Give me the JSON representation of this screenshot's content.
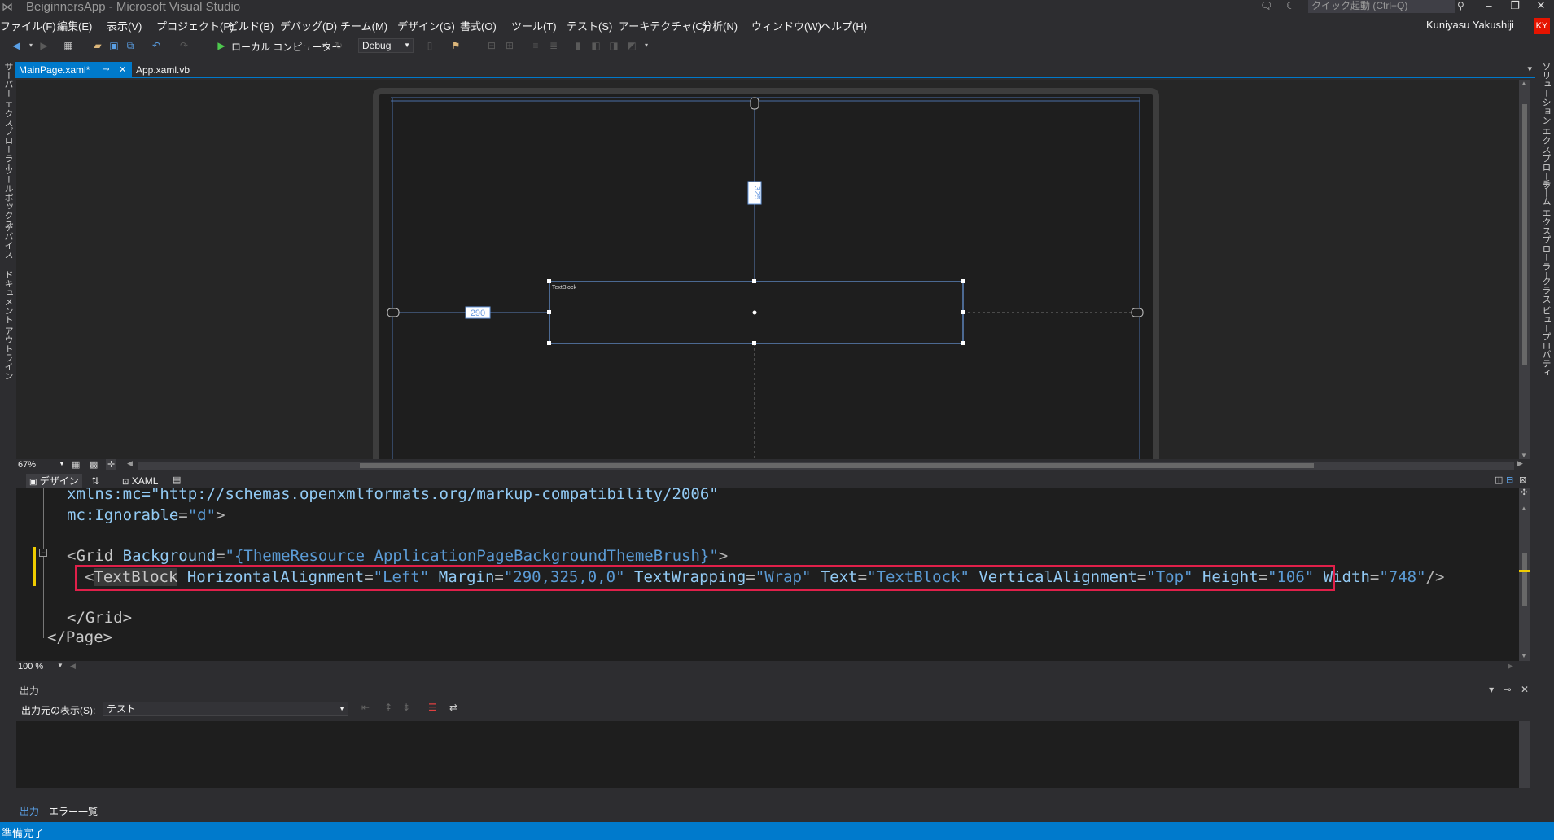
{
  "window": {
    "title": "BeiginnersApp - Microsoft Visual Studio",
    "quick_launch_placeholder": "クイック起動 (Ctrl+Q)",
    "user_name": "Kuniyasu Yakushiji",
    "user_initials": "KY"
  },
  "menu": [
    "ファイル(F)",
    "編集(E)",
    "表示(V)",
    "プロジェクト(P)",
    "ビルド(B)",
    "デバッグ(D)",
    "チーム(M)",
    "デザイン(G)",
    "書式(O)",
    "ツール(T)",
    "テスト(S)",
    "アーキテクチャ(C)",
    "分析(N)",
    "ウィンドウ(W)",
    "ヘルプ(H)"
  ],
  "toolbar": {
    "run_target": "ローカル コンピューター",
    "configuration": "Debug"
  },
  "left_tool_tabs": [
    "サーバー エクスプローラー",
    "ツールボックス",
    "デバイス",
    "ドキュメント アウトライン"
  ],
  "right_tool_tabs": [
    "ソリューション エクスプローラー",
    "チーム エクスプローラー",
    "クラス ビュー",
    "プロパティ"
  ],
  "doc_tabs": [
    {
      "label": "MainPage.xaml*",
      "active": true
    },
    {
      "label": "App.xaml.vb",
      "active": false
    }
  ],
  "designer": {
    "element_label": "TextBlock",
    "margin_top": "325",
    "margin_left": "290",
    "zoom": "67%"
  },
  "split_tabs": {
    "design": "デザイン",
    "swap": "⇅",
    "xaml": "XAML"
  },
  "code": {
    "line1": "xmlns:mc=\"http://schemas.openxmlformats.org/markup-compatibility/2006\"",
    "line2_attr": "mc:Ignorable",
    "line2_val": "\"d\"",
    "grid_el": "Grid",
    "grid_attr": "Background",
    "grid_val": "\"{ThemeResource ApplicationPageBackgroundThemeBrush}\"",
    "tb_el": "TextBlock",
    "tb_attrs": [
      {
        "name": "HorizontalAlignment",
        "value": "\"Left\""
      },
      {
        "name": "Margin",
        "value": "\"290,325,0,0\""
      },
      {
        "name": "TextWrapping",
        "value": "\"Wrap\""
      },
      {
        "name": "Text",
        "value": "\"TextBlock\""
      },
      {
        "name": "VerticalAlignment",
        "value": "\"Top\""
      },
      {
        "name": "Height",
        "value": "\"106\""
      },
      {
        "name": "Width",
        "value": "\"748\""
      }
    ],
    "grid_close": "</Grid>",
    "page_close": "</Page>",
    "editor_zoom": "100 %"
  },
  "output": {
    "title": "出力",
    "source_label": "出力元の表示(S):",
    "source_value": "テスト"
  },
  "bottom_tabs": [
    "出力",
    "エラー一覧"
  ],
  "status": "準備完了",
  "colors": {
    "accent": "#007acc",
    "highlight_border": "#e0204a",
    "change_marker": "#efcc00"
  }
}
